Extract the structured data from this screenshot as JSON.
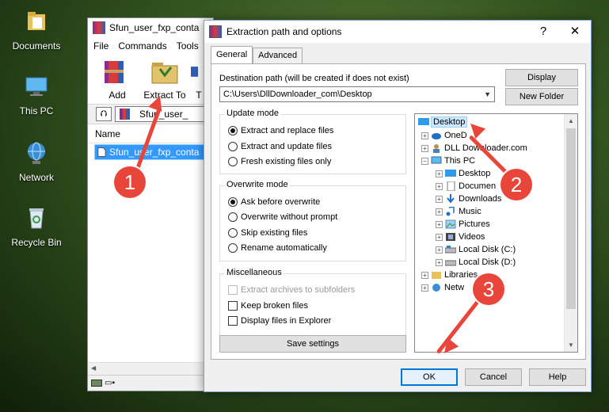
{
  "desktop": {
    "icons": [
      {
        "label": "Documents"
      },
      {
        "label": "This PC"
      },
      {
        "label": "Network"
      },
      {
        "label": "Recycle Bin"
      }
    ]
  },
  "winrar": {
    "title": "Sfun_user_fxp_conta",
    "menu": [
      "File",
      "Commands",
      "Tools"
    ],
    "toolbar": {
      "add": "Add",
      "extract_to": "Extract To",
      "third": "T"
    },
    "path": "Sfun_user_",
    "list_header": "Name",
    "file": "Sfun_user_fxp_conta"
  },
  "dialog": {
    "title": "Extraction path and options",
    "help": "?",
    "close": "✕",
    "tabs": [
      "General",
      "Advanced"
    ],
    "dest_label": "Destination path (will be created if does not exist)",
    "dest_value": "C:\\Users\\DllDownloader_com\\Desktop",
    "display_button": "Display",
    "new_folder_button": "New Folder",
    "update_mode": {
      "title": "Update mode",
      "options": [
        "Extract and replace files",
        "Extract and update files",
        "Fresh existing files only"
      ],
      "selected": 0
    },
    "overwrite_mode": {
      "title": "Overwrite mode",
      "options": [
        "Ask before overwrite",
        "Overwrite without prompt",
        "Skip existing files",
        "Rename automatically"
      ],
      "selected": 0
    },
    "misc": {
      "title": "Miscellaneous",
      "options": [
        "Extract archives to subfolders",
        "Keep broken files",
        "Display files in Explorer"
      ]
    },
    "save_settings": "Save settings",
    "tree": [
      "Desktop",
      "OneD",
      "DLL Downloader.com",
      "This PC",
      "Desktop",
      "Documen",
      "Downloads",
      "Music",
      "Pictures",
      "Videos",
      "Local Disk (C:)",
      "Local Disk (D:)",
      "Libraries",
      "Netw"
    ],
    "ok": "OK",
    "cancel": "Cancel",
    "help_button": "Help"
  },
  "markers": [
    "1",
    "2",
    "3"
  ],
  "accent_color": "#e8463b"
}
